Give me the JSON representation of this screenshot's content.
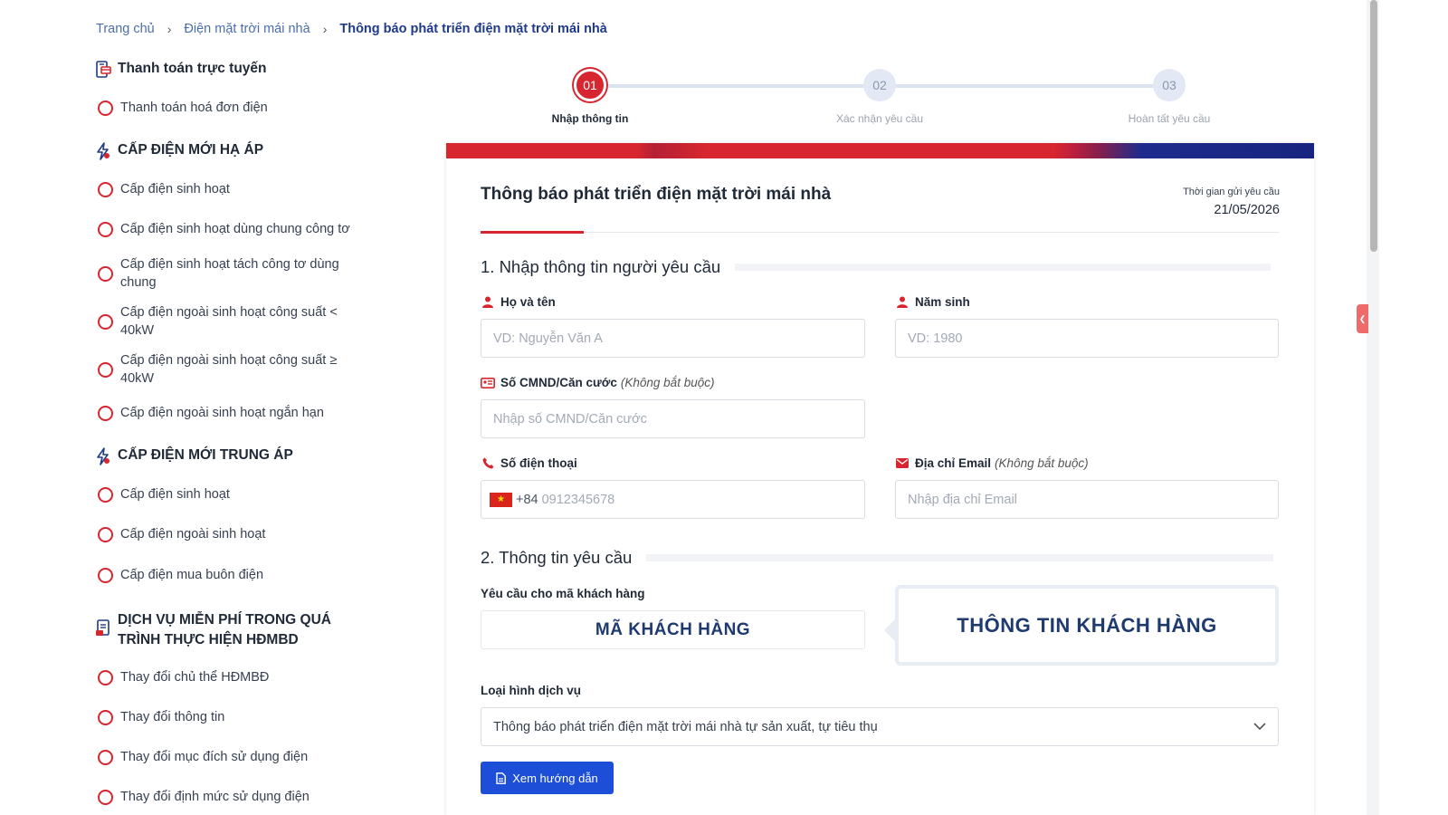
{
  "breadcrumb": {
    "home": "Trang chủ",
    "parent": "Điện mặt trời mái nhà",
    "current": "Thông báo phát triển điện mặt trời mái nhà"
  },
  "sidebar": {
    "sections": [
      {
        "title": "Thanh toán trực tuyến",
        "icon": "payment-icon"
      },
      {
        "title": "CẤP ĐIỆN MỚI HẠ ÁP",
        "icon": "lightning-icon"
      },
      {
        "title": "CẤP ĐIỆN MỚI TRUNG ÁP",
        "icon": "lightning-icon"
      },
      {
        "title": "DỊCH VỤ MIỄN PHÍ TRONG QUÁ TRÌNH THỰC HIỆN HĐMBD",
        "icon": "document-icon"
      }
    ],
    "items": [
      "Thanh toán hoá đơn điện",
      "Cấp điện sinh hoạt",
      "Cấp điện sinh hoạt dùng chung công tơ",
      "Cấp điện sinh hoạt tách công tơ dùng chung",
      "Cấp điện ngoài sinh hoạt công suất < 40kW",
      "Cấp điện ngoài sinh hoạt công suất ≥ 40kW",
      "Cấp điện ngoài sinh hoạt ngắn hạn",
      "Cấp điện sinh hoạt",
      "Cấp điện ngoài sinh hoạt",
      "Cấp điện mua buôn điện",
      "Thay đổi chủ thể HĐMBĐ",
      "Thay đổi thông tin",
      "Thay đổi mục đích sử dụng điện",
      "Thay đổi định mức sử dụng điện"
    ]
  },
  "stepper": {
    "steps": [
      {
        "num": "01",
        "label": "Nhập thông tin",
        "active": true
      },
      {
        "num": "02",
        "label": "Xác nhận yêu cầu",
        "active": false
      },
      {
        "num": "03",
        "label": "Hoàn tất yêu cầu",
        "active": false
      }
    ]
  },
  "form": {
    "title": "Thông báo phát triển điện mặt trời mái nhà",
    "time_label": "Thời gian gửi yêu cầu",
    "time_value": "21/05/2026",
    "section1": "1. Nhập thông tin người yêu cầu",
    "name_label": "Họ và tên",
    "name_placeholder": "VD: Nguyễn Văn A",
    "birth_label": "Năm sinh",
    "birth_placeholder": "VD: 1980",
    "id_label": "Số CMND/Căn cước",
    "id_optional": "(Không bắt buộc)",
    "id_placeholder": "Nhập số CMND/Căn cước",
    "phone_label": "Số điện thoại",
    "phone_code": "+84",
    "phone_placeholder": "0912345678",
    "email_label": "Địa chỉ Email",
    "email_optional": "(Không bắt buộc)",
    "email_placeholder": "Nhập địa chỉ Email",
    "section2": "2. Thông tin yêu cầu",
    "customer_code_label": "Yêu cầu cho mã khách hàng",
    "customer_code_box": "MÃ KHÁCH HÀNG",
    "customer_info_box": "THÔNG TIN KHÁCH HÀNG",
    "service_label": "Loại hình dịch vụ",
    "service_value": "Thông báo phát triển điện mặt trời mái nhà tự sản xuất, tự tiêu thụ",
    "guide_button": "Xem hướng dẫn"
  },
  "colors": {
    "accent_red": "#d7262f",
    "primary_blue": "#1d4ed8",
    "navy_text": "#1e3a6e"
  }
}
